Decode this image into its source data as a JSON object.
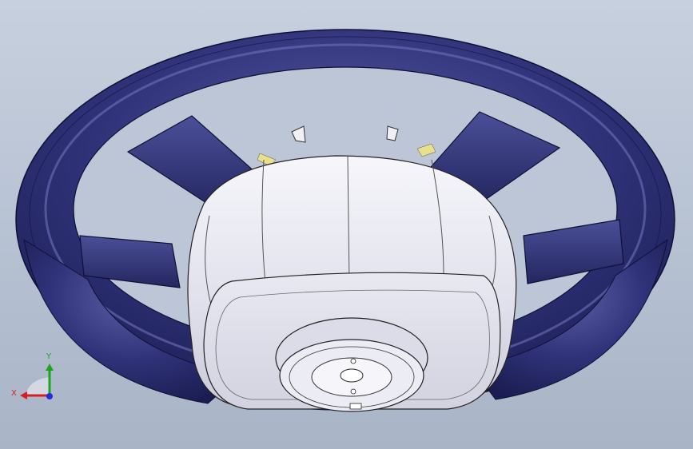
{
  "viewport": {
    "model": "steering-wheel",
    "background_top": "#c7d0de",
    "background_bottom": "#a9b4c7",
    "rim_color": "#2a2d6e",
    "hub_color": "#e6e6f0",
    "accent_color": "#e8e08a"
  },
  "triad": {
    "x_label": "X",
    "y_label": "Y",
    "x_color": "#d81e1e",
    "y_color": "#1ea51e",
    "z_color": "#1e2fd8"
  }
}
